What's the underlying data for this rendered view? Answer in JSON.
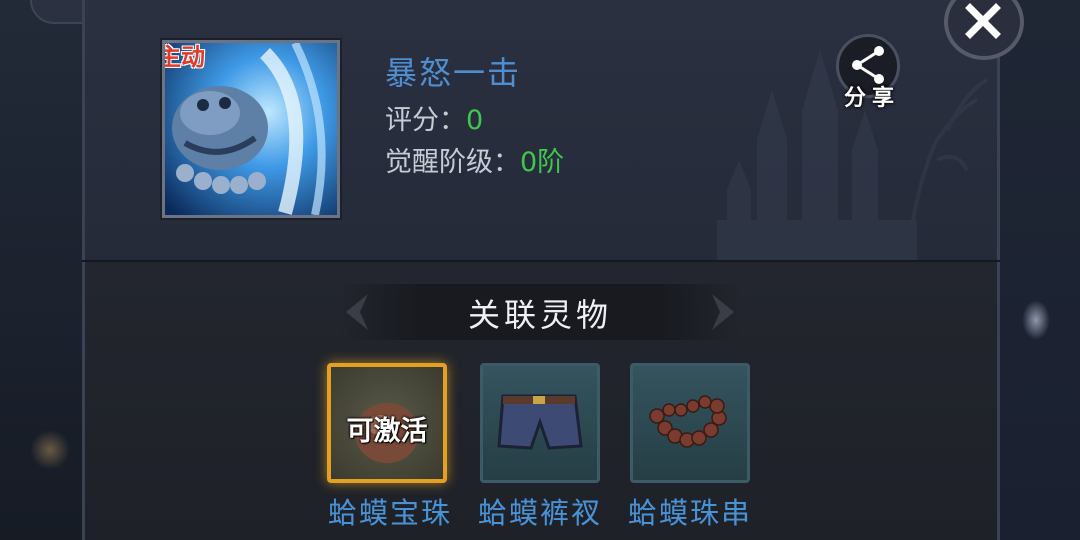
{
  "skill": {
    "badge": "主动",
    "name": "暴怒一击",
    "score_label": "评分：",
    "score_value": "0",
    "awaken_label": "觉醒阶级：",
    "awaken_value": "0阶"
  },
  "share": {
    "label": "分享",
    "icon": "share-icon"
  },
  "close": {
    "icon": "close-icon"
  },
  "section": {
    "title": "关联灵物"
  },
  "items": [
    {
      "name": "蛤蟆宝珠",
      "status": "可激活",
      "icon": "orb-icon"
    },
    {
      "name": "蛤蟆裤衩",
      "status": "",
      "icon": "shorts-icon"
    },
    {
      "name": "蛤蟆珠串",
      "status": "",
      "icon": "beads-icon"
    }
  ],
  "colors": {
    "name_blue": "#4f8fd0",
    "value_green": "#3ec74a",
    "item_label_blue": "#4a92d6",
    "active_border": "#e6a021"
  }
}
